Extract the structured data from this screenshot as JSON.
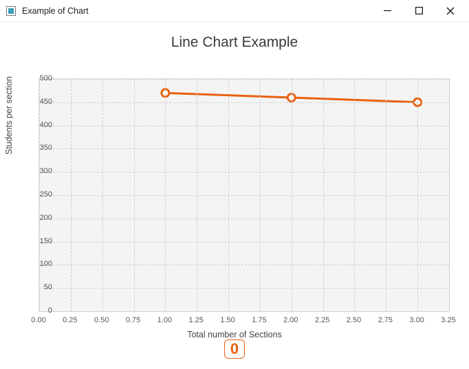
{
  "window": {
    "title": "Example of Chart"
  },
  "chart_data": {
    "type": "line",
    "title": "Line Chart Example",
    "xlabel": "Total number of Sections",
    "ylabel": "Students per section",
    "x": [
      1,
      2,
      3
    ],
    "y": [
      470,
      460,
      450
    ],
    "xlim": [
      0.0,
      3.25
    ],
    "ylim": [
      0,
      500
    ],
    "x_ticks": [
      "0.00",
      "0.25",
      "0.50",
      "0.75",
      "1.00",
      "1.25",
      "1.50",
      "1.75",
      "2.00",
      "2.25",
      "2.50",
      "2.75",
      "3.00",
      "3.25"
    ],
    "y_ticks": [
      "0",
      "50",
      "100",
      "150",
      "200",
      "250",
      "300",
      "350",
      "400",
      "450",
      "500"
    ],
    "series_color": "#e9610f",
    "marker": "circle-open"
  },
  "footer": {
    "value": "0"
  }
}
